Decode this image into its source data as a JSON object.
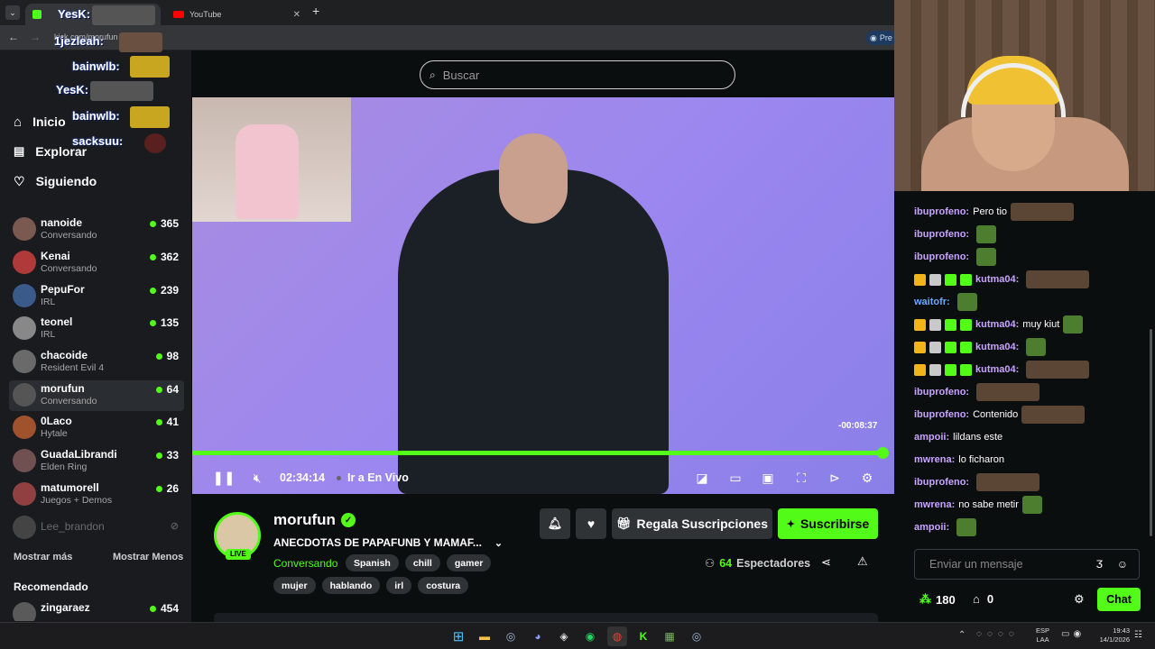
{
  "browser": {
    "tabs": [
      {
        "label": "",
        "active": true
      },
      {
        "label": "YouTube",
        "active": false
      }
    ],
    "new_tab": "+",
    "address": "kick.com/morufun",
    "profile_btn": "Pre"
  },
  "overlay": {
    "lines": [
      {
        "user": "YesK:"
      },
      {
        "user": "1jezleah:"
      },
      {
        "user": "bainwlb:"
      },
      {
        "user": "YesK:"
      },
      {
        "user": "bainwlb:"
      },
      {
        "user": "sacksuu:"
      }
    ]
  },
  "search": {
    "placeholder": "Buscar"
  },
  "sidebar": {
    "nav": [
      {
        "label": "Inicio"
      },
      {
        "label": "Explorar"
      },
      {
        "label": "Siguiendo"
      }
    ],
    "channels": [
      {
        "name": "nanoide",
        "category": "Conversando",
        "viewers": "365"
      },
      {
        "name": "Kenai",
        "category": "Conversando",
        "viewers": "362"
      },
      {
        "name": "PepuFor",
        "category": "IRL",
        "viewers": "239"
      },
      {
        "name": "teonel",
        "category": "IRL",
        "viewers": "135"
      },
      {
        "name": "chacoide",
        "category": "Resident Evil 4",
        "viewers": "98"
      },
      {
        "name": "morufun",
        "category": "Conversando",
        "viewers": "64"
      },
      {
        "name": "0Laco",
        "category": "Hytale",
        "viewers": "41"
      },
      {
        "name": "GuadaLibrandi",
        "category": "Elden Ring",
        "viewers": "33"
      },
      {
        "name": "matumorell",
        "category": "Juegos + Demos",
        "viewers": "26"
      }
    ],
    "offline": "Lee_brandon",
    "show_more": "Mostrar más",
    "show_less": "Mostrar Menos",
    "recommended_title": "Recomendado",
    "recommended": [
      {
        "name": "zingaraez",
        "viewers": "454"
      }
    ]
  },
  "player": {
    "remaining": "-00:08:37",
    "time": "02:34:14",
    "go_live": "Ir a En Vivo",
    "progress": 0.975
  },
  "stream": {
    "channel": "morufun",
    "live_badge": "LIVE",
    "title": "ANECDOTAS DE PAPAFUNB Y MAMAF...",
    "category": "Conversando",
    "tags": [
      "Spanish",
      "chill",
      "gamer",
      "mujer",
      "hablando",
      "irl",
      "costura"
    ],
    "viewers": "64",
    "viewers_label": "Espectadores",
    "gift_label": "Regala Suscripciones",
    "subscribe_label": "Suscribirse"
  },
  "chat": {
    "messages": [
      {
        "user": "ibuprofeno:",
        "text": "Pero tio",
        "emote": "face"
      },
      {
        "user": "ibuprofeno:",
        "text": "",
        "emote": "green"
      },
      {
        "user": "ibuprofeno:",
        "text": "",
        "emote": "green"
      },
      {
        "user": "kutma04:",
        "text": "",
        "emote": "face",
        "badges": true
      },
      {
        "user": "waitofr:",
        "text": "",
        "emote": "green",
        "blue": true
      },
      {
        "user": "kutma04:",
        "text": "muy kiut",
        "emote": "green",
        "badges": true
      },
      {
        "user": "kutma04:",
        "text": "",
        "emote": "green",
        "badges": true
      },
      {
        "user": "kutma04:",
        "text": "",
        "emote": "face",
        "badges": true
      },
      {
        "user": "ibuprofeno:",
        "text": "",
        "emote": "face"
      },
      {
        "user": "ibuprofeno:",
        "text": "Contenido",
        "emote": "face"
      },
      {
        "user": "ampoii:",
        "text": "lildans este",
        "emote": ""
      },
      {
        "user": "mwrena:",
        "text": "lo ficharon",
        "emote": ""
      },
      {
        "user": "ibuprofeno:",
        "text": "",
        "emote": "face"
      },
      {
        "user": "mwrena:",
        "text": "no sabe metir",
        "emote": "green"
      },
      {
        "user": "ampoii:",
        "text": "",
        "emote": "green"
      }
    ],
    "input_placeholder": "Enviar un mensaje",
    "points": "180",
    "store_count": "0",
    "send_label": "Chat"
  },
  "taskbar": {
    "lang_top": "ESP",
    "lang_bottom": "LAA",
    "time": "19:43",
    "date": "14/1/2026"
  },
  "colors": {
    "accent": "#53fc18",
    "bg": "#0b0e0f",
    "sidebar": "#191b1f"
  }
}
